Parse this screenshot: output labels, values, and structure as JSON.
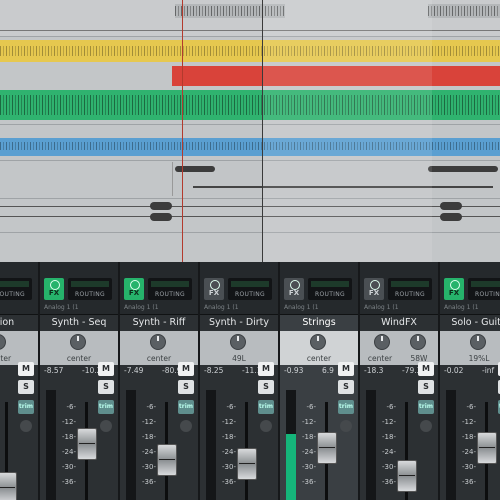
{
  "arrange": {
    "lanes": [
      {
        "color": "#c6c8ca"
      },
      {
        "color": "#e9cf56"
      },
      {
        "color": "#d9433a"
      },
      {
        "color": "#2fb36f"
      },
      {
        "color": "#5a9fd1"
      },
      {
        "color": "#c8cacc"
      },
      {
        "color": "#c8cacc"
      }
    ]
  },
  "mixer": {
    "strips": [
      {
        "id": "percussion",
        "name": "ussion",
        "fx_on": false,
        "routing": "ROUTING",
        "io": "",
        "pan": "center",
        "db_left": "",
        "db_right": "",
        "meter_level": 0.22,
        "fader_level": 0.0,
        "selected": false
      },
      {
        "id": "synth-seq",
        "name": "Synth - Seq",
        "fx_on": true,
        "routing": "ROUTING",
        "io": "Analog 1 (1",
        "pan": "center",
        "db_left": "-8.57",
        "db_right": "-10.2",
        "meter_level": 0.0,
        "fader_level": 0.55,
        "selected": false
      },
      {
        "id": "synth-riff",
        "name": "Synth - Riff",
        "fx_on": true,
        "routing": "ROUTING",
        "io": "Analog 1 (1",
        "pan": "center",
        "db_left": "-7.49",
        "db_right": "-80.9",
        "meter_level": 0.0,
        "fader_level": 0.35,
        "selected": false
      },
      {
        "id": "synth-dirty",
        "name": "Synth - Dirty",
        "fx_on": false,
        "routing": "ROUTING",
        "io": "Analog 1 (1",
        "pan": "49L",
        "db_left": "-8.25",
        "db_right": "-11.1",
        "meter_level": 0.0,
        "fader_level": 0.3,
        "selected": false
      },
      {
        "id": "strings",
        "name": "Strings",
        "fx_on": false,
        "routing": "ROUTING",
        "io": "Analog 1 (1",
        "pan": "center",
        "db_left": "-0.93",
        "db_right": "6.9",
        "meter_level": 0.6,
        "fader_level": 0.5,
        "selected": true
      },
      {
        "id": "windfx",
        "name": "WindFX",
        "fx_on": false,
        "routing": "ROUTING",
        "io": "Analog 1 (1",
        "pan": "center",
        "pan2": "58W",
        "db_left": "-18.3",
        "db_right": "-79.3",
        "meter_level": 0.0,
        "fader_level": 0.15,
        "selected": false
      },
      {
        "id": "solo-guitar",
        "name": "Solo - Guita",
        "fx_on": true,
        "routing": "ROUTING",
        "io": "Analog 1 (1",
        "pan": "19%L",
        "db_left": "-0.02",
        "db_right": "-inf",
        "meter_level": 0.0,
        "fader_level": 0.5,
        "selected": false
      }
    ],
    "scale": [
      "-6-",
      "-12-",
      "-18-",
      "-24-",
      "-30-",
      "-36-"
    ],
    "mute_label": "M",
    "solo_label": "S",
    "trim_label": "trim"
  }
}
